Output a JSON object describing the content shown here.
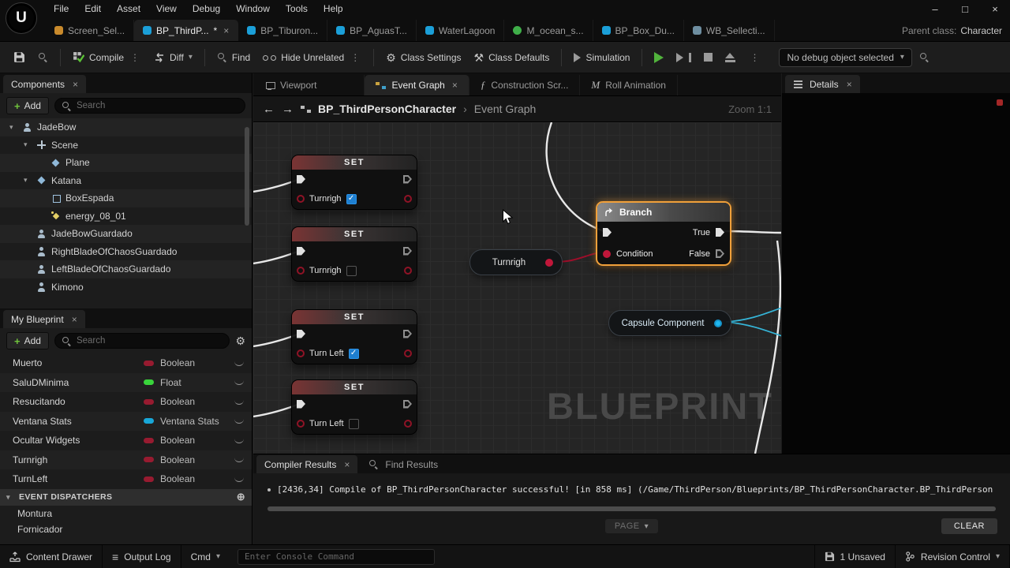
{
  "icons": {
    "minimize": "–",
    "maximize": "□",
    "close": "×",
    "kebab": "⋮",
    "chevron_down": "▾",
    "back_arrow": "←",
    "forward_arrow": "→",
    "breadcrumb_sep": "›",
    "plus": "+",
    "gear": "⚙",
    "wrench": "⚒",
    "circle_plus": "⊕",
    "check": "✓",
    "construction_icon": "ƒ",
    "animation_icon": "M",
    "output_log_icon": "≡",
    "unreal_logo": "U"
  },
  "colors": {
    "accent_blue": "#26a2d9",
    "compile_check_green": "#5bc236",
    "play_green": "#51b33c",
    "bool_type": "#971b30",
    "float_type": "#39d43b",
    "struct_type": "#18a7d8",
    "exec_wire": "#e8e8e8",
    "bool_wire": "#9e0e2a",
    "object_wire": "#35b5d8",
    "selection_orange": "#f0a03a"
  },
  "window": {
    "menu": [
      "File",
      "Edit",
      "Asset",
      "View",
      "Debug",
      "Window",
      "Tools",
      "Help"
    ]
  },
  "asset_tabs": {
    "items": [
      {
        "label": "Screen_Sel...",
        "icon_color": "#c98a2c"
      },
      {
        "label": "BP_ThirdP...",
        "dirty": "*",
        "icon_color": "#1b9fd8"
      },
      {
        "label": "BP_Tiburon...",
        "icon_color": "#1b9fd8"
      },
      {
        "label": "BP_AguasT...",
        "icon_color": "#1b9fd8"
      },
      {
        "label": "WaterLagoon",
        "icon_color": "#1b9fd8"
      },
      {
        "label": "M_ocean_s...",
        "icon_color": "#3fae49"
      },
      {
        "label": "BP_Box_Du...",
        "icon_color": "#1b9fd8"
      },
      {
        "label": "WB_Sellecti...",
        "icon_color": "#6e8ea0"
      }
    ],
    "parent_class_label": "Parent class:",
    "parent_class_value": "Character"
  },
  "toolbar": {
    "compile_label": "Compile",
    "diff_label": "Diff",
    "find_label": "Find",
    "hide_unrelated_label": "Hide Unrelated",
    "class_settings_label": "Class Settings",
    "class_defaults_label": "Class Defaults",
    "simulation_label": "Simulation",
    "debug_dropdown": "No debug object selected"
  },
  "components_panel": {
    "title": "Components",
    "add_label": "Add",
    "search_placeholder": "Search",
    "tree": [
      {
        "label": "JadeBow"
      },
      {
        "label": "Scene"
      },
      {
        "label": "Plane"
      },
      {
        "label": "Katana"
      },
      {
        "label": "BoxEspada"
      },
      {
        "label": "energy_08_01"
      },
      {
        "label": "JadeBowGuardado"
      },
      {
        "label": "RightBladeOfChaosGuardado"
      },
      {
        "label": "LeftBladeOfChaosGuardado"
      },
      {
        "label": "Kimono"
      }
    ]
  },
  "my_blueprint_panel": {
    "title": "My Blueprint",
    "add_label": "Add",
    "search_placeholder": "Search",
    "variables": [
      {
        "name": "Muerto",
        "type": "Boolean",
        "type_color": "#971b30"
      },
      {
        "name": "SaluDMinima",
        "type": "Float",
        "type_color": "#39d43b"
      },
      {
        "name": "Resucitando",
        "type": "Boolean",
        "type_color": "#971b30"
      },
      {
        "name": "Ventana Stats",
        "type": "Ventana Stats",
        "type_color": "#18a7d8"
      },
      {
        "name": "Ocultar Widgets",
        "type": "Boolean",
        "type_color": "#971b30"
      },
      {
        "name": "Turnrigh",
        "type": "Boolean",
        "type_color": "#971b30"
      },
      {
        "name": "TurnLeft",
        "type": "Boolean",
        "type_color": "#971b30"
      }
    ],
    "event_dispatchers_title": "EVENT DISPATCHERS",
    "dispatchers": [
      {
        "name": "Montura"
      },
      {
        "name": "Fornicador"
      }
    ]
  },
  "graph": {
    "tabs": {
      "viewport": "Viewport",
      "event_graph": "Event Graph",
      "construction": "Construction Scr...",
      "roll": "Roll Animation"
    },
    "breadcrumb": {
      "root": "BP_ThirdPersonCharacter",
      "current": "Event Graph"
    },
    "zoom_label": "Zoom 1:1",
    "watermark": "BLUEPRINT",
    "set_nodes": [
      {
        "title": "SET",
        "var_name": "Turnrigh",
        "checked": true
      },
      {
        "title": "SET",
        "var_name": "Turnrigh",
        "checked": false
      },
      {
        "title": "SET",
        "var_name": "Turn Left",
        "checked": true
      },
      {
        "title": "SET",
        "var_name": "Turn Left",
        "checked": false
      }
    ],
    "branch": {
      "title": "Branch",
      "condition_label": "Condition",
      "true_label": "True",
      "false_label": "False"
    },
    "getter": {
      "label": "Turnrigh"
    },
    "capsule": {
      "label": "Capsule Component"
    }
  },
  "details_panel": {
    "title": "Details"
  },
  "bottom_panel": {
    "compiler_tab": "Compiler Results",
    "find_tab": "Find Results",
    "log_line": "[2436,34] Compile of BP_ThirdPersonCharacter successful!  [in 858 ms] (/Game/ThirdPerson/Blueprints/BP_ThirdPersonCharacter.BP_ThirdPerson",
    "page_label": "PAGE",
    "clear_label": "CLEAR"
  },
  "statusbar": {
    "content_drawer": "Content Drawer",
    "output_log": "Output Log",
    "cmd_label": "Cmd",
    "console_placeholder": "Enter Console Command",
    "unsaved": "1 Unsaved",
    "revision_control": "Revision Control"
  }
}
